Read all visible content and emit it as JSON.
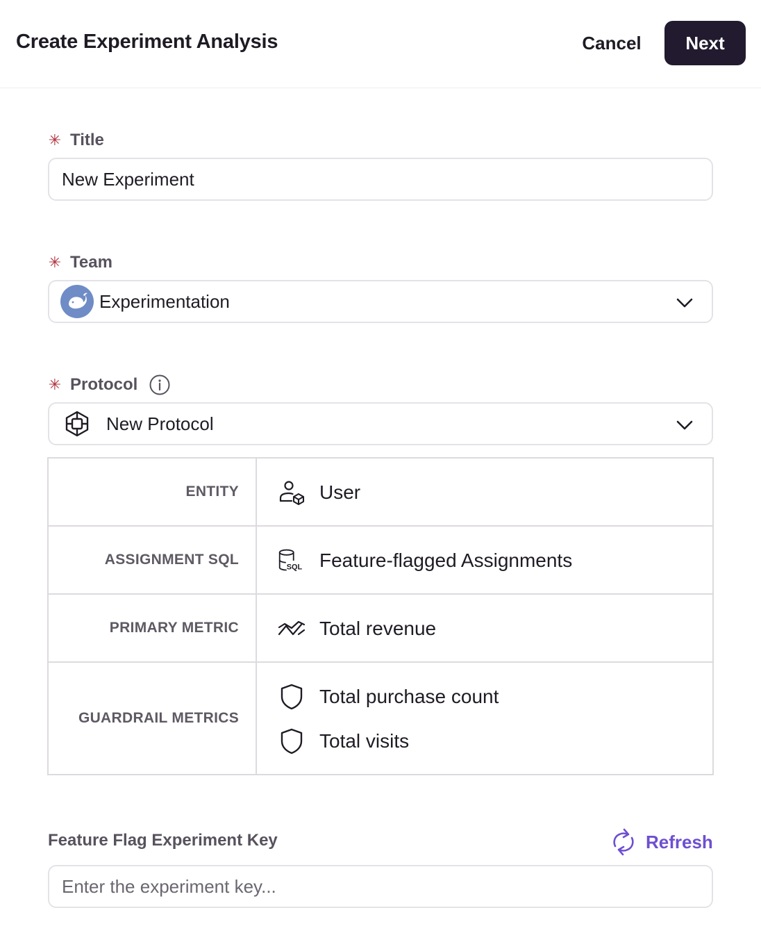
{
  "header": {
    "title": "Create Experiment Analysis",
    "cancel_label": "Cancel",
    "next_label": "Next"
  },
  "form": {
    "title": {
      "label": "Title",
      "required_mark": "✳",
      "value": "New Experiment"
    },
    "team": {
      "label": "Team",
      "required_mark": "✳",
      "value": "Experimentation",
      "avatar_icon": "whale-icon"
    },
    "protocol": {
      "label": "Protocol",
      "required_mark": "✳",
      "info_icon": "info-icon",
      "value": "New Protocol",
      "icon": "protocol-icon"
    }
  },
  "protocol_details": {
    "entity": {
      "label": "ENTITY",
      "value": "User",
      "icon": "user-entity-icon"
    },
    "assignment_sql": {
      "label": "ASSIGNMENT SQL",
      "value": "Feature-flagged Assignments",
      "icon": "sql-database-icon"
    },
    "primary_metric": {
      "label": "PRIMARY METRIC",
      "value": "Total revenue",
      "icon": "metric-trend-icon"
    },
    "guardrail_metrics": {
      "label": "GUARDRAIL METRICS",
      "items": [
        {
          "value": "Total purchase count",
          "icon": "shield-icon"
        },
        {
          "value": "Total visits",
          "icon": "shield-icon"
        }
      ]
    }
  },
  "feature_flag": {
    "label": "Feature Flag Experiment Key",
    "refresh_label": "Refresh",
    "placeholder": "Enter the experiment key..."
  },
  "colors": {
    "primary_button": "#221a2e",
    "required_mark": "#b0333f",
    "accent_link": "#6e4fd1",
    "avatar": "#6f8cc6"
  }
}
